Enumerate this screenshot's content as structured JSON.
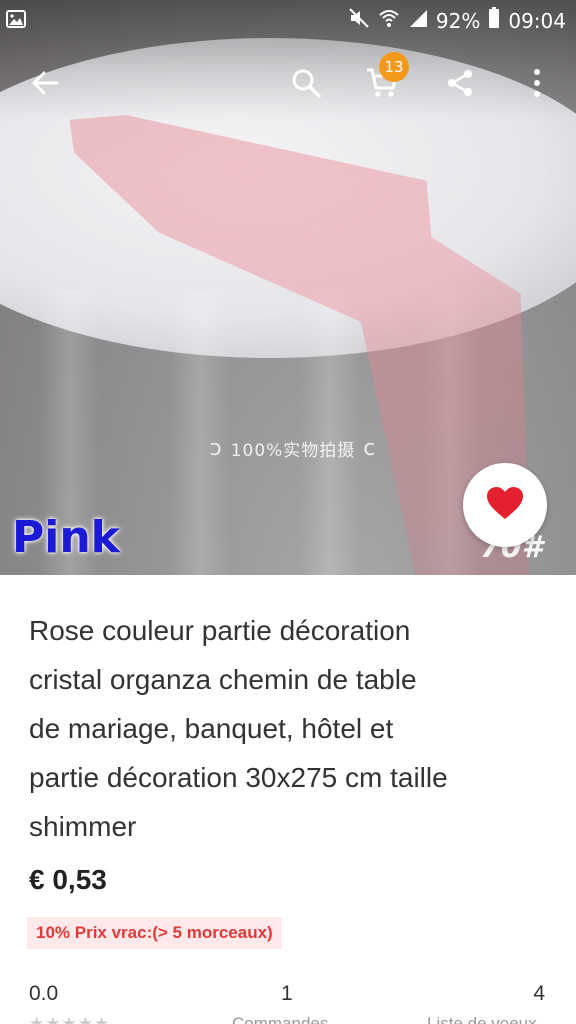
{
  "status_bar": {
    "battery": "92%",
    "time": "09:04"
  },
  "cart": {
    "badge_count": "13"
  },
  "photo": {
    "watermark": "100%实物拍摄",
    "color_label": "Pink",
    "corner_number": "70#"
  },
  "product": {
    "title_lines": [
      "Rose couleur partie décoration",
      "cristal organza chemin de table",
      "de mariage, banquet, hôtel et",
      "partie décoration 30x275 cm taille",
      "shimmer"
    ],
    "price": "€ 0,53",
    "bulk_price": "10% Prix vrac:(> 5 morceaux)"
  },
  "stats": {
    "rating": "0.0",
    "stars": "★★★★★",
    "orders": "1",
    "orders_label": "Commandes",
    "wishlist": "4",
    "wishlist_label": "Liste de voeux"
  },
  "colors": {
    "favorite_heart": "#e5202e",
    "cart_badge": "#f39a1a",
    "bulk_text": "#e03a3a",
    "bulk_bg": "#fde9ea",
    "color_label": "#1b1bd6"
  },
  "icons": [
    "image-icon",
    "mute-icon",
    "wifi-icon",
    "signal-icon",
    "battery-icon",
    "back-arrow-icon",
    "search-icon",
    "cart-icon",
    "share-icon",
    "more-vertical-icon",
    "heart-icon"
  ]
}
